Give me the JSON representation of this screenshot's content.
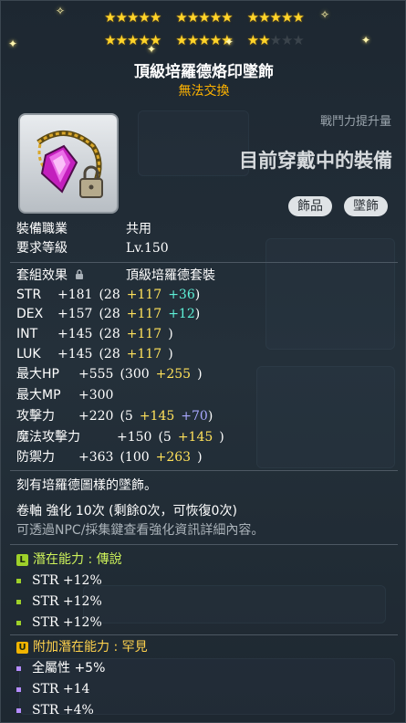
{
  "stars": {
    "row1": [
      5,
      5,
      5
    ],
    "row2_filled": 12,
    "row2_total": 15,
    "filled_color": "#ffd42a",
    "empty_color": "#3a434b"
  },
  "item": {
    "name": "頂級培羅德烙印墜飾",
    "trade_status": "無法交換",
    "icon": "pendant-lock-icon"
  },
  "header": {
    "cp_label": "戰鬥力提升量",
    "equipped_text": "目前穿戴中的裝備",
    "badges": [
      "飾品",
      "墜飾"
    ]
  },
  "requirements": {
    "job_label": "裝備職業",
    "job_value": "共用",
    "level_label": "要求等級",
    "level_value": "Lv.150"
  },
  "set": {
    "label": "套組效果",
    "value": "頂級培羅德套裝"
  },
  "stats": [
    {
      "name": "STR",
      "total": "+181",
      "open": "(28",
      "add": "+117",
      "extra": "+36",
      "extra_color": "cyan",
      "close": ")"
    },
    {
      "name": "DEX",
      "total": "+157",
      "open": "(28",
      "add": "+117",
      "extra": "+12",
      "extra_color": "cyan",
      "close": ")"
    },
    {
      "name": "INT",
      "total": "+145",
      "open": "(28",
      "add": "+117",
      "extra": "",
      "extra_color": "",
      "close": ")"
    },
    {
      "name": "LUK",
      "total": "+145",
      "open": "(28",
      "add": "+117",
      "extra": "",
      "extra_color": "",
      "close": ")"
    },
    {
      "name": "最大HP",
      "total": "+555",
      "open": "(300",
      "add": "+255",
      "extra": "",
      "extra_color": "",
      "close": ")"
    },
    {
      "name": "最大MP",
      "total": "+300",
      "open": "",
      "add": "",
      "extra": "",
      "extra_color": "",
      "close": ""
    },
    {
      "name": "攻擊力",
      "total": "+220",
      "open": "(5",
      "add": "+145",
      "extra": "+70",
      "extra_color": "blue",
      "close": ")"
    },
    {
      "name": "魔法攻擊力",
      "total": "+150",
      "open": "(5",
      "add": "+145",
      "extra": "",
      "extra_color": "",
      "close": ")"
    },
    {
      "name": "防禦力",
      "total": "+363",
      "open": "(100",
      "add": "+263",
      "extra": "",
      "extra_color": "",
      "close": ")"
    }
  ],
  "description": "刻有培羅德圖樣的墜飾。",
  "scroll_text": "卷軸 強化 10次 (剩餘0次，可恢復0次)",
  "hint_text": "可透過NPC/採集鍵查看強化資訊詳細內容。",
  "potential": {
    "title": "潛在能力 : 傳說",
    "icon_letter": "L",
    "icon_color": "#9ed12a",
    "lines": [
      "STR +12%",
      "STR +12%",
      "STR +12%"
    ]
  },
  "additional": {
    "title": "附加潛在能力 : 罕見",
    "icon_letter": "U",
    "icon_color": "#f0b400",
    "lines": [
      "全屬性 +5%",
      "STR +14",
      "STR +4%"
    ]
  }
}
